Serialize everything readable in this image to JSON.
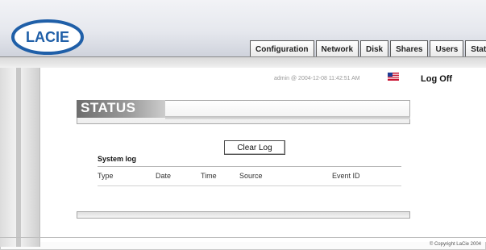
{
  "header": {
    "logo_text": "LACIE",
    "tabs": [
      {
        "label": "Configuration"
      },
      {
        "label": "Network"
      },
      {
        "label": "Disk"
      },
      {
        "label": "Shares"
      },
      {
        "label": "Users"
      },
      {
        "label": "Status"
      }
    ]
  },
  "session": {
    "info": "admin @ 2004-12-08 11:42:51 AM",
    "language_flag_icon": "us-flag-icon",
    "logoff_label": "Log Off"
  },
  "page": {
    "title": "STATUS",
    "clear_log_label": "Clear Log",
    "log_heading": "System log",
    "columns": [
      "Type",
      "Date",
      "Time",
      "Source",
      "Event ID"
    ]
  },
  "footer": {
    "copyright": "© Copyright LaCie 2004"
  },
  "colors": {
    "header_top": "#f2f3f6",
    "header_bottom": "#cfd3dc",
    "logo_blue": "#1f5fa8",
    "title_gray": "#7a7a7a"
  }
}
